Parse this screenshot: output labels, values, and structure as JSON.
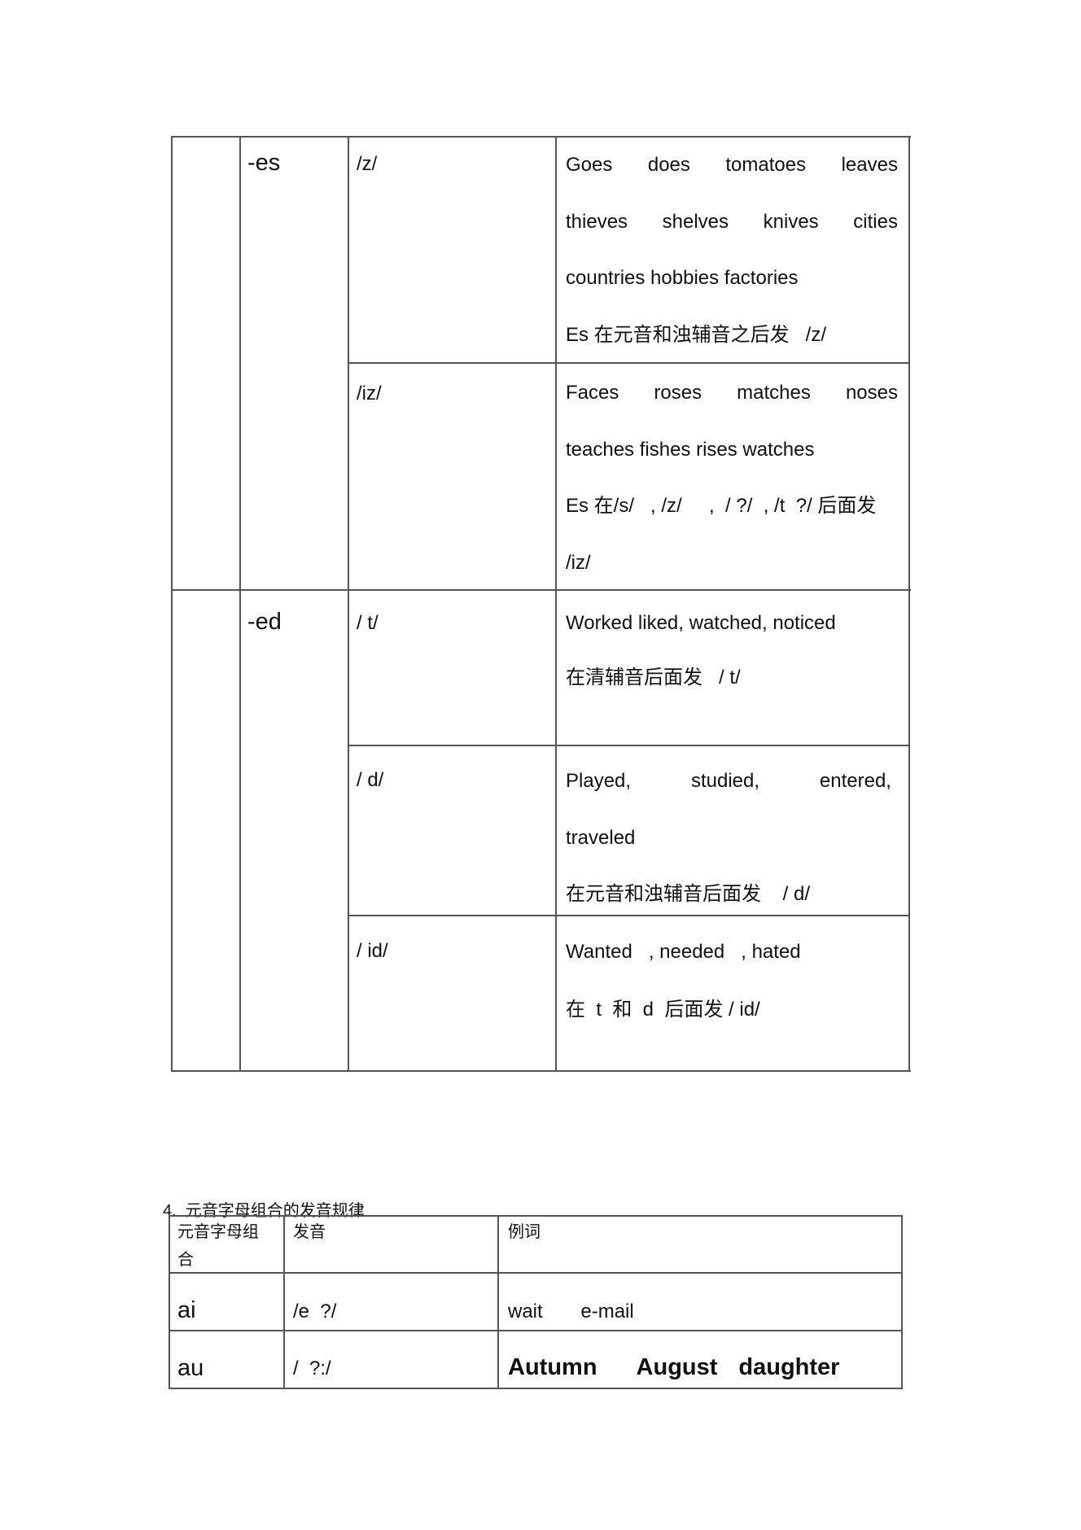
{
  "table1": {
    "groups": [
      {
        "category": "",
        "suffix": "-es",
        "rows": [
          {
            "phoneme": "/z/",
            "example_lines": [
              [
                "Goes",
                "does",
                "tomatoes",
                "leaves"
              ],
              [
                "thieves",
                "shelves",
                "knives",
                "cities"
              ]
            ],
            "example_text": "countries hobbies factories",
            "rule": "Es 在元音和浊辅音之后发   /z/"
          },
          {
            "phoneme": "/iz/",
            "example_lines": [
              [
                "Faces",
                "roses",
                "matches",
                "noses"
              ]
            ],
            "example_text": "teaches fishes rises watches",
            "rule": "Es 在/s/   , /z/     ,  / ?/  , /t  ?/ 后面发",
            "rule_cont": "/iz/"
          }
        ]
      },
      {
        "category": "",
        "suffix": "-ed",
        "rows": [
          {
            "phoneme": "/ t/",
            "example_text": "Worked liked, watched, noticed",
            "rule": "在清辅音后面发   / t/"
          },
          {
            "phoneme": "/ d/",
            "example_lines": [
              [
                "Played,",
                "studied,",
                "entered,"
              ]
            ],
            "example_text": "traveled",
            "rule": "在元音和浊辅音后面发    / d/"
          },
          {
            "phoneme": "/ id/",
            "example_text": "Wanted   , needed   , hated",
            "rule": "在  t  和  d  后面发 / id/"
          }
        ]
      }
    ]
  },
  "section4": {
    "heading": "4.  元音字母组合的发音规律",
    "headers": [
      "元音字母组",
      "合",
      "发音",
      "例词"
    ],
    "rows": [
      {
        "combo": "ai",
        "sound": "/e  ?/",
        "examples": "wait       e-mail"
      },
      {
        "combo": "au",
        "sound": "/  ?:/",
        "examples": [
          "Autumn",
          "August",
          "daughter"
        ]
      }
    ]
  }
}
